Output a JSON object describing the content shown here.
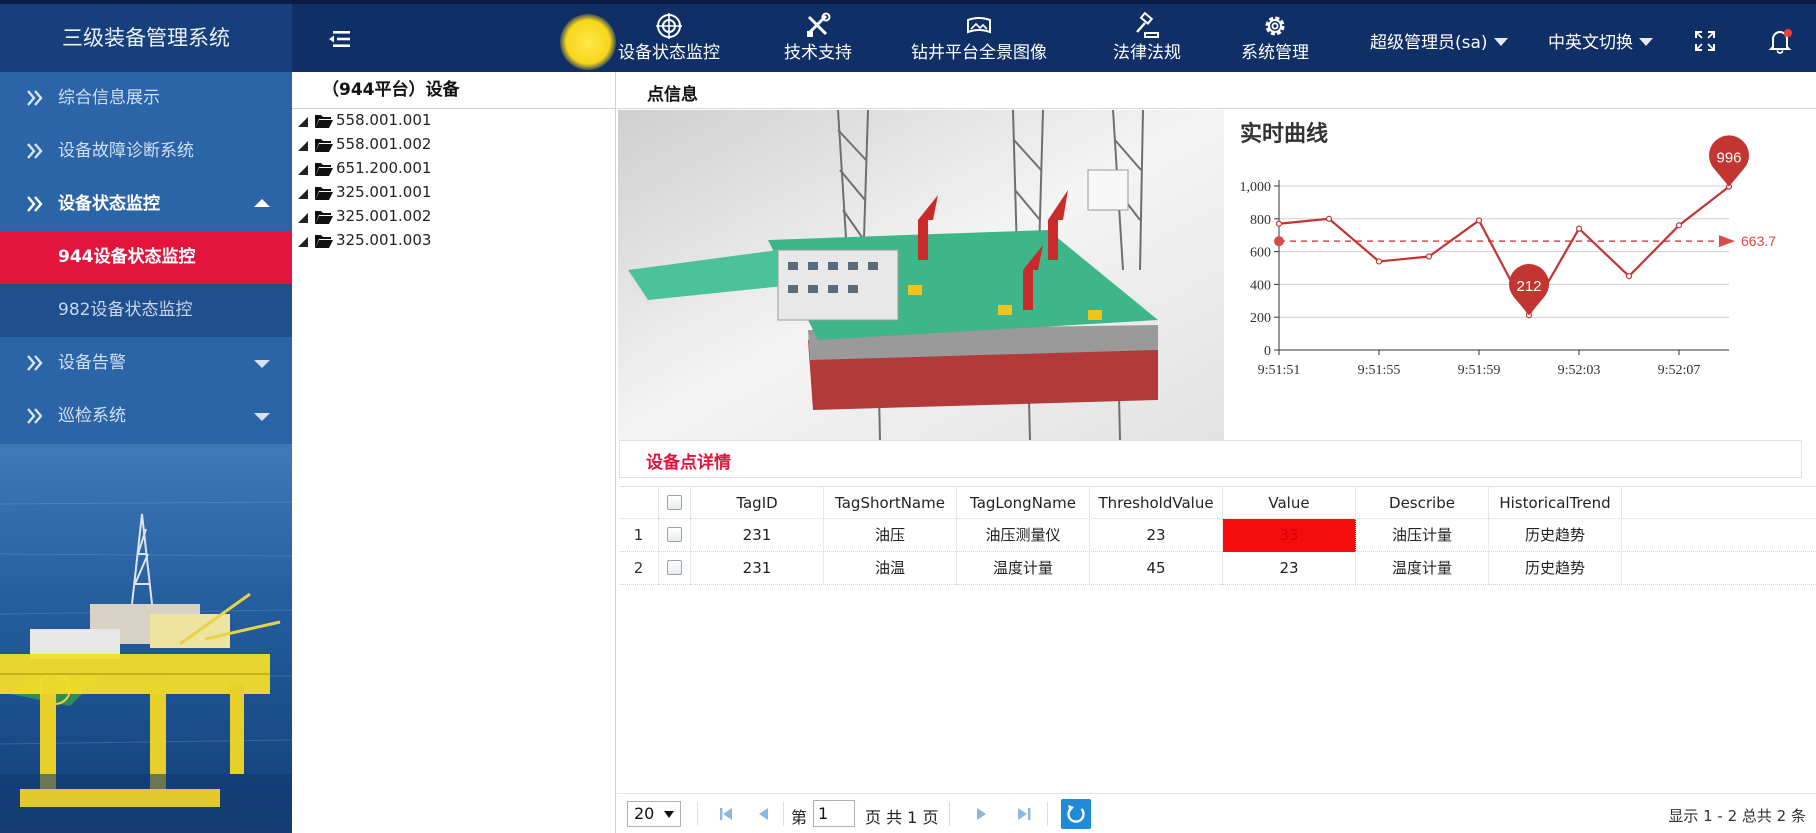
{
  "app": {
    "title": "三级装备管理系统"
  },
  "topnav": {
    "items": [
      {
        "label": "设备状态监控",
        "icon": "monitor-target-icon"
      },
      {
        "label": "技术支持",
        "icon": "tools-icon"
      },
      {
        "label": "钻井平台全景图像",
        "icon": "panorama-icon"
      },
      {
        "label": "法律法规",
        "icon": "gavel-icon"
      },
      {
        "label": "系统管理",
        "icon": "gear-icon"
      }
    ],
    "user": "超级管理员(sa)",
    "language": "中英文切换"
  },
  "sidebar": {
    "items": [
      {
        "label": "综合信息展示"
      },
      {
        "label": "设备故障诊断系统"
      },
      {
        "label": "设备状态监控"
      },
      {
        "label": "944设备状态监控"
      },
      {
        "label": "982设备状态监控"
      },
      {
        "label": "设备告警"
      },
      {
        "label": "巡检系统"
      }
    ]
  },
  "tree": {
    "title": "（944平台）设备",
    "nodes": [
      "558.001.001",
      "558.001.002",
      "651.200.001",
      "325.001.001",
      "325.001.002",
      "325.001.003"
    ]
  },
  "point": {
    "title": "点信息"
  },
  "chart_data": {
    "type": "line",
    "title": "实时曲线",
    "x": [
      "9:51:51",
      "9:51:53",
      "9:51:55",
      "9:51:57",
      "9:51:59",
      "9:52:01",
      "9:52:03",
      "9:52:05",
      "9:52:07",
      "9:52:09"
    ],
    "xticks": [
      "9:51:51",
      "9:51:55",
      "9:51:59",
      "9:52:03",
      "9:52:07"
    ],
    "values": [
      770,
      800,
      540,
      570,
      790,
      212,
      740,
      450,
      760,
      996
    ],
    "ylim": [
      0,
      1000
    ],
    "yticks": [
      "0",
      "200",
      "400",
      "600",
      "800",
      "1,000"
    ],
    "markpoint_max": "996",
    "markpoint_min": "212",
    "markline_average": 663.7,
    "markline_label": "663.7",
    "grid": true,
    "color": "#c23531"
  },
  "details": {
    "title": "设备点详情",
    "columns": [
      "TagID",
      "TagShortName",
      "TagLongName",
      "ThresholdValue",
      "Value",
      "Describe",
      "HistoricalTrend"
    ],
    "rows": [
      {
        "index": "1",
        "TagID": "231",
        "TagShortName": "油压",
        "TagLongName": "油压测量仪",
        "ThresholdValue": "23",
        "Value": "33",
        "Describe": "油压计量",
        "HistoricalTrend": "历史趋势"
      },
      {
        "index": "2",
        "TagID": "231",
        "TagShortName": "油温",
        "TagLongName": "温度计量",
        "ThresholdValue": "45",
        "Value": "23",
        "Describe": "温度计量",
        "HistoricalTrend": "历史趋势"
      }
    ]
  },
  "pager": {
    "page_size": "20",
    "page_prefix": "第",
    "page_value": "1",
    "page_suffix": "页 共 1 页",
    "summary": "显示 1 - 2 总共 2 条"
  },
  "colors": {
    "header": "#0f2f66",
    "sidebar": "#2a62a6",
    "active": "#e3153d",
    "alert_cell": "#f50d0d"
  }
}
